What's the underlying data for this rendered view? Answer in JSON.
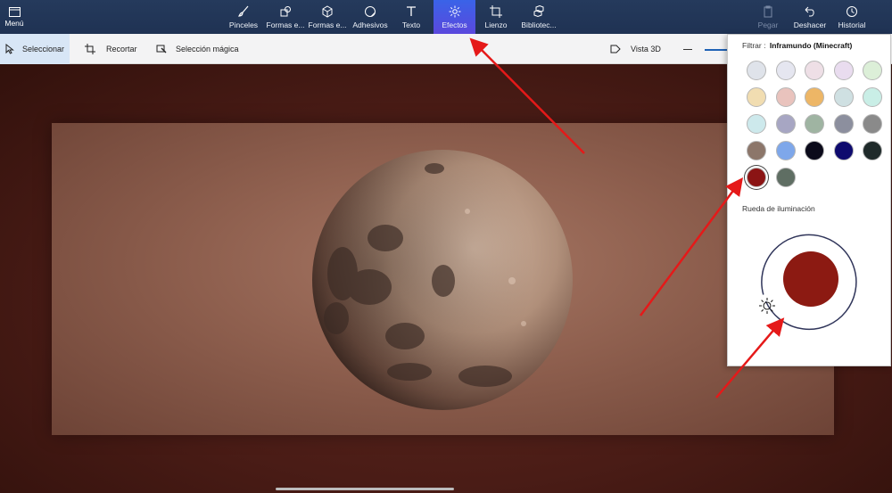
{
  "ribbon": {
    "menu_label": "Menú",
    "tools": [
      {
        "label": "Pinceles",
        "icon": "brush-icon"
      },
      {
        "label": "Formas e...",
        "icon": "shapes-2d-icon"
      },
      {
        "label": "Formas e...",
        "icon": "shapes-3d-icon"
      },
      {
        "label": "Adhesivos",
        "icon": "sticker-icon"
      },
      {
        "label": "Texto",
        "icon": "text-icon"
      },
      {
        "label": "Efectos",
        "icon": "effects-sun-icon",
        "active": true
      },
      {
        "label": "Lienzo",
        "icon": "canvas-icon"
      },
      {
        "label": "Bibliotec...",
        "icon": "library-icon"
      }
    ],
    "right_tools": [
      {
        "label": "Pegar",
        "icon": "paste-icon",
        "disabled": true
      },
      {
        "label": "Deshacer",
        "icon": "undo-icon"
      },
      {
        "label": "Historial",
        "icon": "history-icon"
      }
    ]
  },
  "subbar": {
    "select_label": "Seleccionar",
    "crop_label": "Recortar",
    "magic_select_label": "Selección mágica",
    "view3d_label": "Vista 3D"
  },
  "panel": {
    "filter_label": "Filtrar :",
    "filter_value": "Inframundo (Minecraft)",
    "swatches": [
      "#dfe3ea",
      "#e5e6f0",
      "#eedfe6",
      "#e9dcef",
      "#dcefd8",
      "#f1ddb1",
      "#e9c3bd",
      "#edb666",
      "#cfe0e2",
      "#c9eee6",
      "#cde9ec",
      "#a7a6c3",
      "#9fb4a2",
      "#8c8f9e",
      "#8a8a8a",
      "#8c766a",
      "#7ea7ea",
      "#0b0a1a",
      "#0e0a6e",
      "#1f2a2a",
      "#8b1414",
      "#5f6e63"
    ],
    "selected_swatch_index": 20,
    "wheel_label": "Rueda de iluminación",
    "wheel_color": "#8c1a12"
  },
  "colors": {
    "ribbon_bg": "#1f3253",
    "accent": "#3f5ce6",
    "annotation_arrow": "#e51919"
  }
}
